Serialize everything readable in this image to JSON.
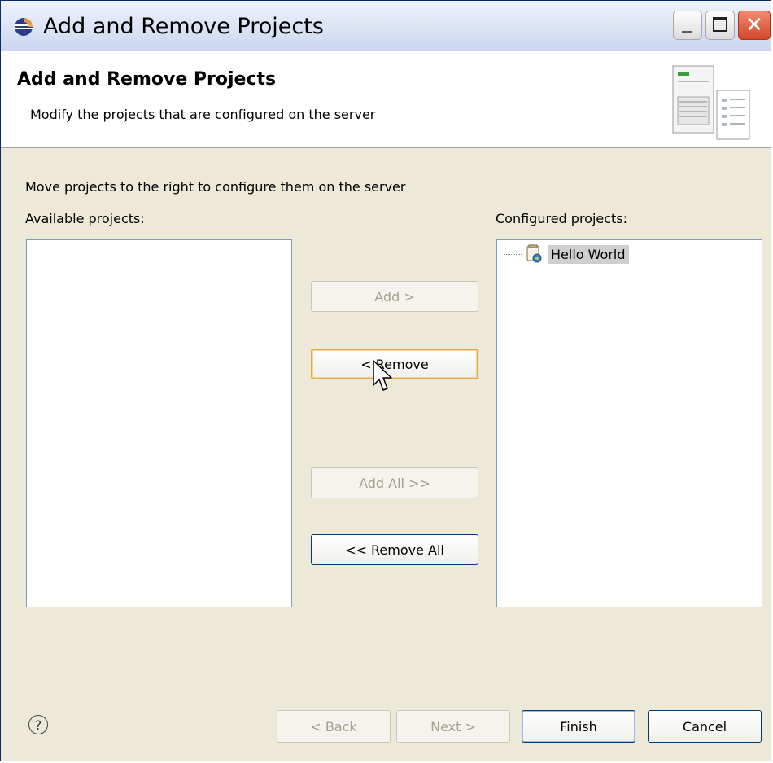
{
  "window": {
    "title": "Add and Remove Projects"
  },
  "banner": {
    "title": "Add and Remove Projects",
    "description": "Modify the projects that are configured on the server"
  },
  "instructions": "Move projects to the right to configure them on the server",
  "available": {
    "label": "Available projects:",
    "items": []
  },
  "configured": {
    "label": "Configured projects:",
    "items": [
      {
        "label": "Hello World",
        "icon": "project-icon",
        "selected": true
      }
    ]
  },
  "buttons": {
    "add": "Add >",
    "remove": "< Remove",
    "add_all": "Add All >>",
    "remove_all": "<< Remove All"
  },
  "footer": {
    "help": "?",
    "back": "< Back",
    "next": "Next >",
    "finish": "Finish",
    "cancel": "Cancel"
  },
  "colors": {
    "accent_border": "#003c74",
    "hover_border": "#e8a84a",
    "close_button": "#d4462a"
  }
}
